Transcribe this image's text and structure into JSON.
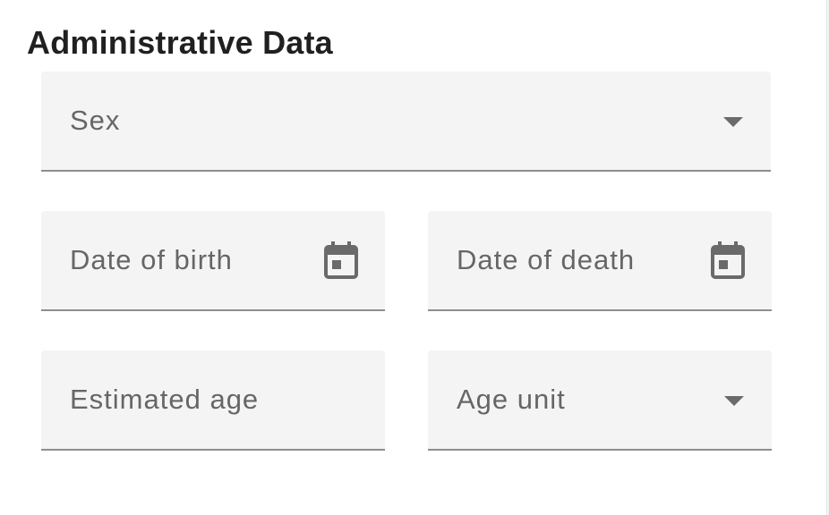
{
  "section": {
    "title": "Administrative Data"
  },
  "fields": {
    "sex": {
      "label": "Sex",
      "icon": "chevron-down-icon"
    },
    "date_of_birth": {
      "label": "Date of birth",
      "icon": "calendar-icon"
    },
    "date_of_death": {
      "label": "Date of death",
      "icon": "calendar-icon"
    },
    "estimated_age": {
      "label": "Estimated age"
    },
    "age_unit": {
      "label": "Age unit",
      "icon": "chevron-down-icon"
    }
  },
  "colors": {
    "field_background": "#f4f4f4",
    "field_underline": "#8e8e8e",
    "label_text": "#666666",
    "title_text": "#202020",
    "icon": "#6a6a6a"
  }
}
